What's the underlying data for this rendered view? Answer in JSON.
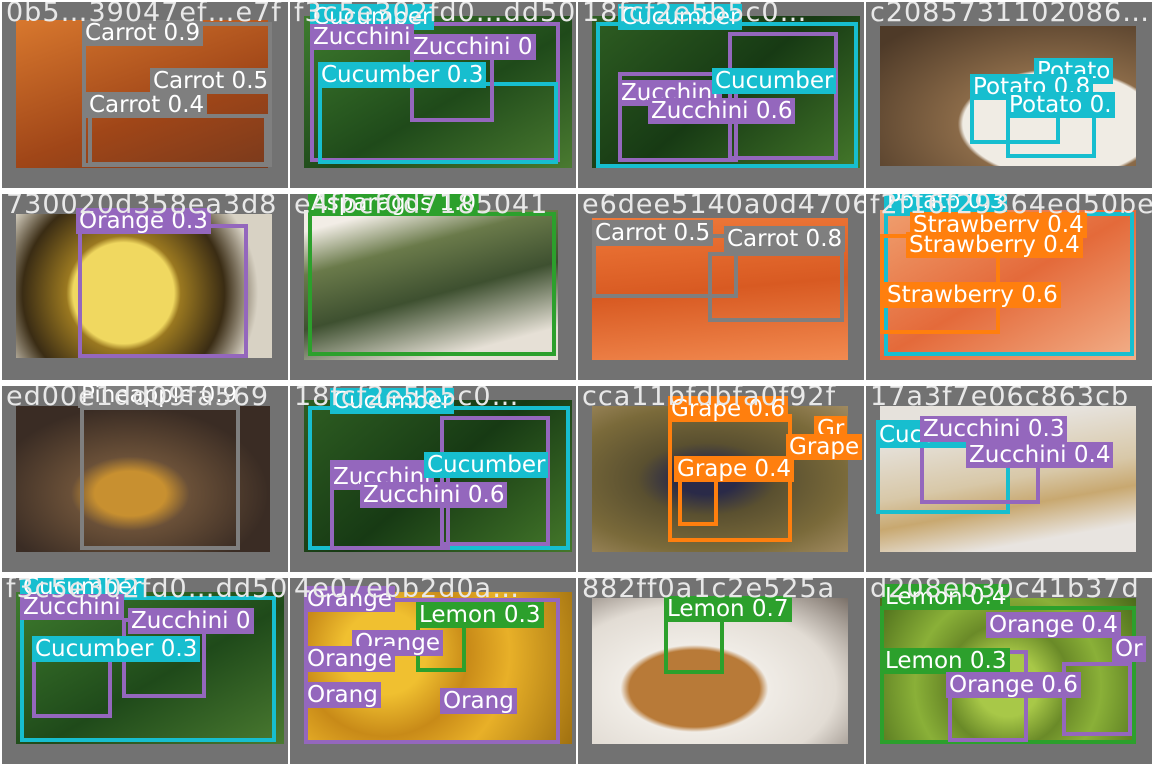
{
  "tiles": [
    {
      "filename": "0b5…39047ef…e7f",
      "photo_color": "#c8622a",
      "labels": [
        "Carrot 0.9",
        "Carrot 0.5",
        "Carrot 0.4"
      ]
    },
    {
      "filename": "f3c5e302fd0…dd50…",
      "photo_color": "#3c6a2c",
      "labels": [
        "Cucumber",
        "Zucchini",
        "Zucchini 0",
        "Cucumber 0.3"
      ]
    },
    {
      "filename": "18fcf2e5b5c0…",
      "photo_color": "#2f5a24",
      "labels": [
        "Cucumber",
        "Zucchini",
        "Zucchini 0.6",
        "Cucumber"
      ]
    },
    {
      "filename": "c2085731102086…",
      "photo_color": "#8a6a4a",
      "labels": [
        "Potato",
        "Potato 0.8",
        "Potato 0."
      ]
    },
    {
      "filename": "730020d358ea3d8",
      "photo_color": "#b88a30",
      "labels": [
        "Orange 0.3"
      ]
    },
    {
      "filename": "e4fbcf0d7185041",
      "photo_color": "#e8e2d8",
      "labels": [
        "Asparagus 1.0"
      ]
    },
    {
      "filename": "e6dee5140a0d4706",
      "photo_color": "#e06a30",
      "labels": [
        "Carrot 0.5",
        "Carrot 0.8"
      ]
    },
    {
      "filename": "f2f16f29364ed50be",
      "photo_color": "#e67a4a",
      "labels": [
        "Potato 0.3",
        "Strawberry 0.4",
        "Strawberry 0.4",
        "Strawberry 0.6"
      ]
    },
    {
      "filename": "ed00e1dd09fa569",
      "photo_color": "#6a5040",
      "labels": [
        "Pineapple 0.9"
      ]
    },
    {
      "filename": "18fcf2e5b5c0…",
      "photo_color": "#2f5a24",
      "labels": [
        "Cucumber",
        "Zucchini",
        "Zucchini 0.6",
        "Cucumber"
      ]
    },
    {
      "filename": "cca11bfdbfa0f92f",
      "photo_color": "#6a5a30",
      "labels": [
        "Grape 0.6",
        "Gr",
        "Grape",
        "Grape 0.4"
      ]
    },
    {
      "filename": "17a3f7e06c863cb",
      "photo_color": "#d8d2c8",
      "labels": [
        "Cucumber",
        "Zucchini 0.3",
        "Zucchini 0.4"
      ]
    },
    {
      "filename": "f3c5e302fd0…dd50…",
      "photo_color": "#3c6a2c",
      "labels": [
        "Cucumber",
        "Zucchini",
        "Zucchini 0",
        "Cucumber 0.3"
      ]
    },
    {
      "filename": "4e07ebb2d0a…",
      "photo_color": "#d8a020",
      "labels": [
        "Orange",
        "Lemon 0.3",
        "Orange",
        "Orange",
        "Orang",
        "Orang"
      ]
    },
    {
      "filename": "882ff0a1c2e525a",
      "photo_color": "#c8b8a8",
      "labels": [
        "Lemon 0.7"
      ]
    },
    {
      "filename": "d208eb30c41b37d",
      "photo_color": "#7aa030",
      "labels": [
        "Lemon 0.4",
        "Orange 0.4",
        "Lemon 0.3",
        "Orange 0.6",
        "Or"
      ]
    }
  ]
}
